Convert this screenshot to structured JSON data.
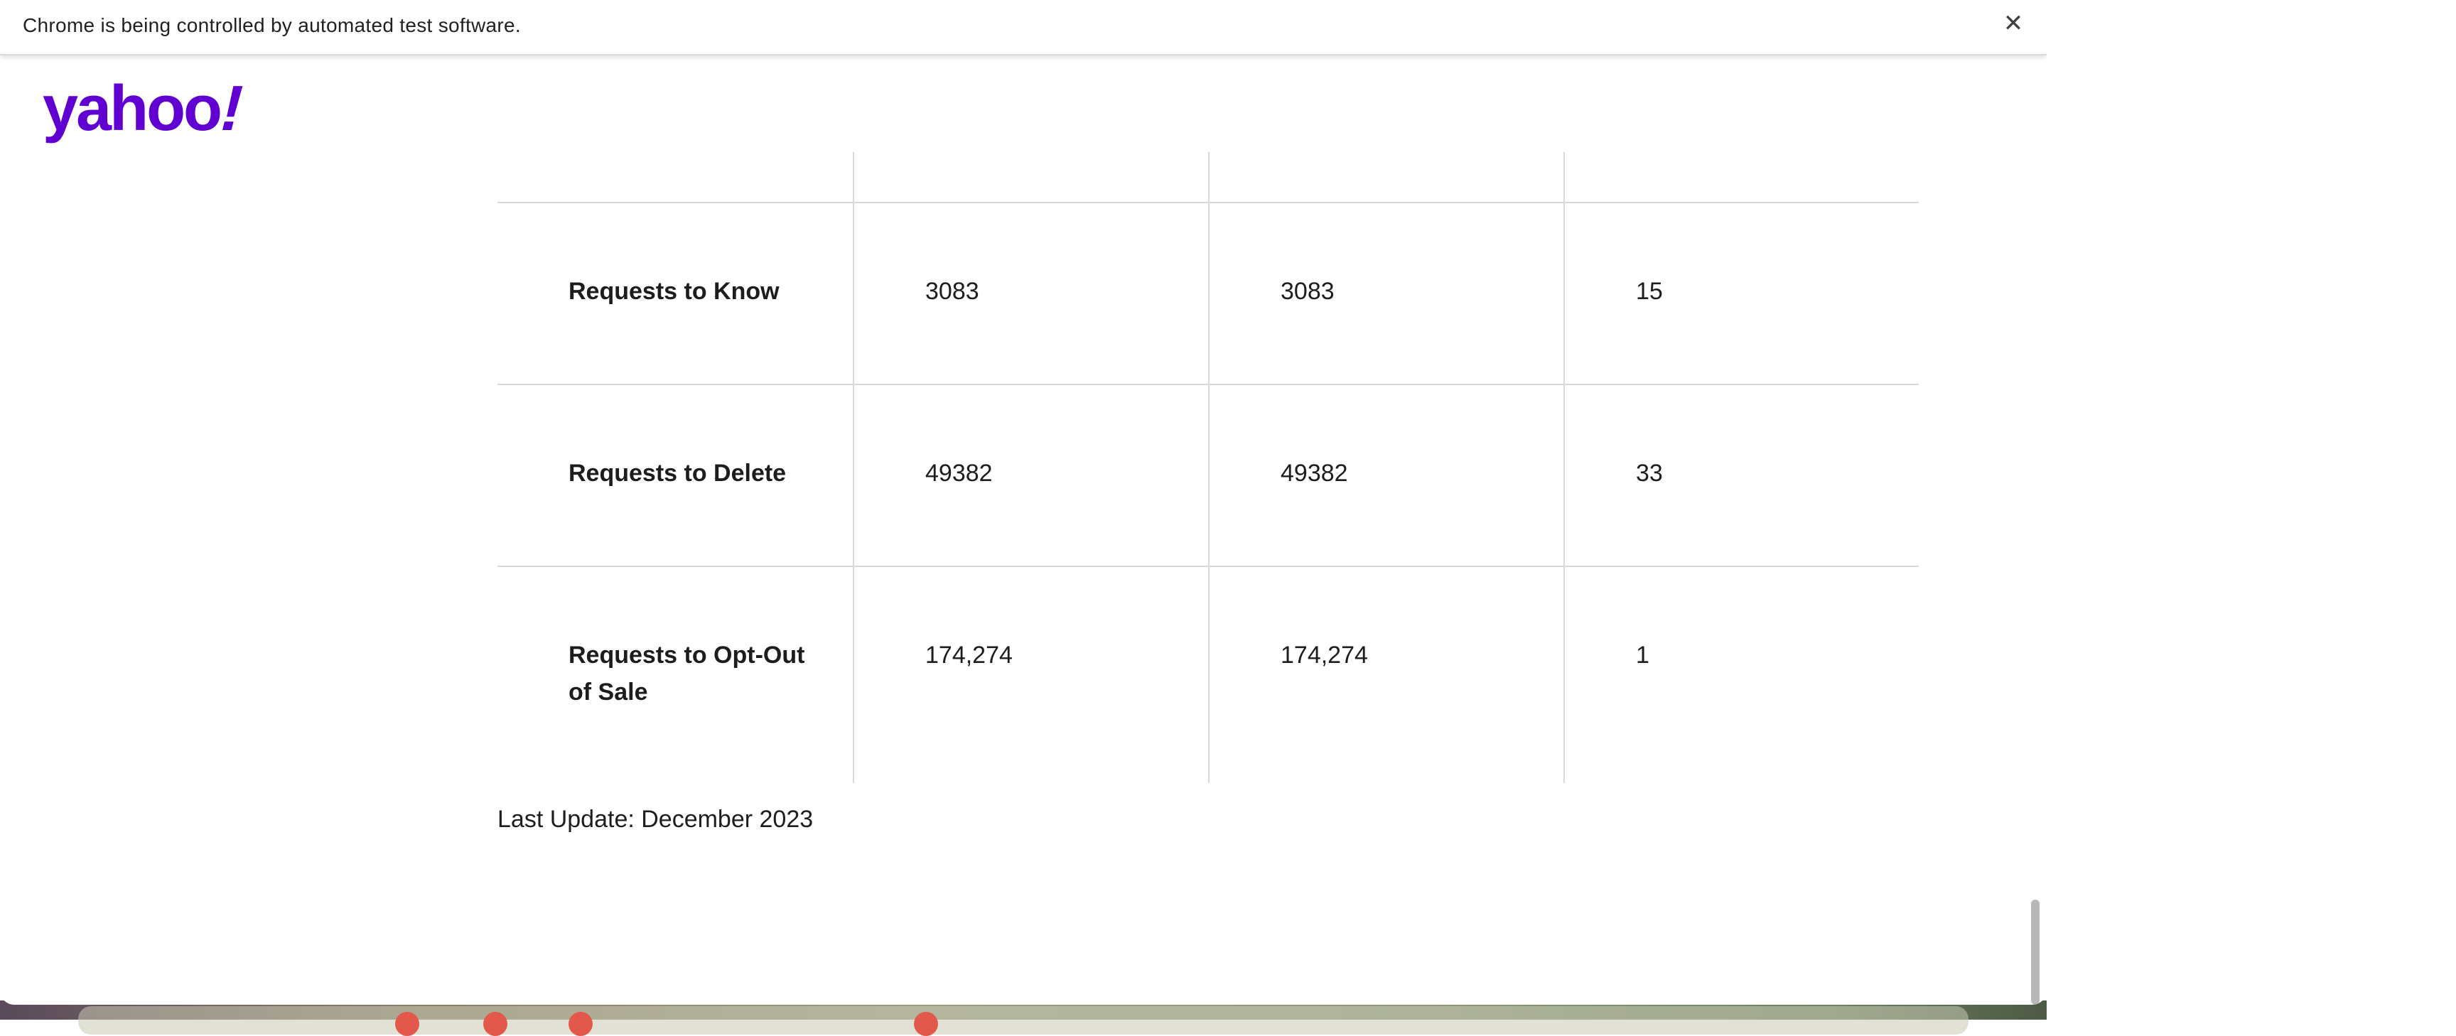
{
  "infobar": {
    "message": "Chrome is being controlled by automated test software.",
    "close_symbol": "✕"
  },
  "header": {
    "logo_text": "yahoo",
    "logo_bang": "!",
    "logo_color": "#6001d2"
  },
  "table": {
    "rows": [
      {
        "label": "Requests to Know",
        "col1": "3083",
        "col2": "3083",
        "col3": "15"
      },
      {
        "label": "Requests to Delete",
        "col1": "49382",
        "col2": "49382",
        "col3": "33"
      },
      {
        "label": "Requests to Opt-Out of Sale",
        "col1": "174,274",
        "col2": "174,274",
        "col3": "1"
      }
    ]
  },
  "footer": {
    "last_update": "Last Update: December 2023"
  },
  "icons": {
    "close": "close-icon"
  }
}
